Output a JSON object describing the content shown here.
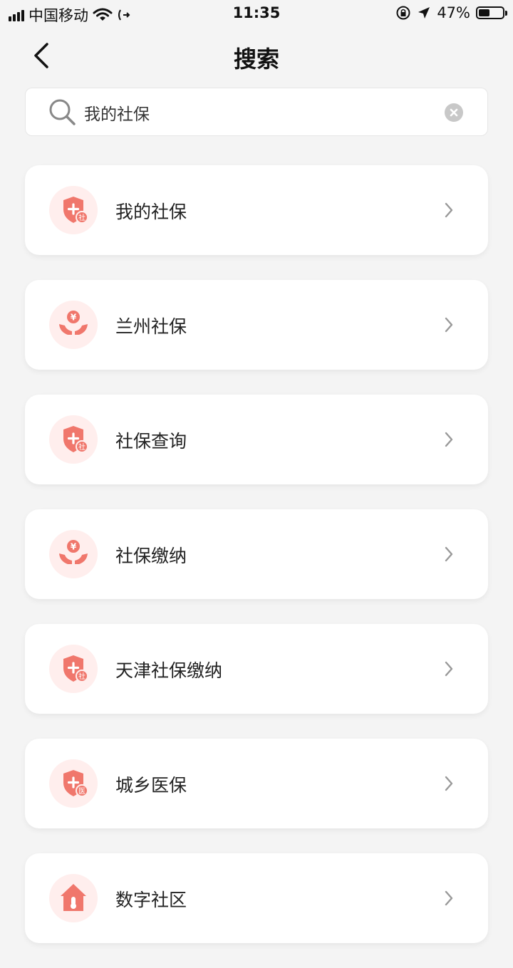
{
  "status_bar": {
    "carrier": "中国移动",
    "time": "11:35",
    "battery_percent_text": "47%",
    "battery_level": 0.47
  },
  "nav": {
    "title": "搜索"
  },
  "search": {
    "value": "我的社保"
  },
  "results": [
    {
      "label": "我的社保",
      "icon": "social-security-shield-icon",
      "badge": "社"
    },
    {
      "label": "兰州社保",
      "icon": "hands-yuan-icon",
      "badge": "¥"
    },
    {
      "label": "社保查询",
      "icon": "social-security-shield-icon",
      "badge": "社"
    },
    {
      "label": "社保缴纳",
      "icon": "hands-yuan-icon",
      "badge": "¥"
    },
    {
      "label": "天津社保缴纳",
      "icon": "social-security-shield-icon",
      "badge": "社"
    },
    {
      "label": "城乡医保",
      "icon": "medical-insurance-shield-icon",
      "badge": "医"
    },
    {
      "label": "数字社区",
      "icon": "community-house-icon",
      "badge": ""
    }
  ],
  "colors": {
    "accent": "#f0776c",
    "icon_bg": "#ffeeed",
    "page_bg": "#f4f4f4"
  }
}
